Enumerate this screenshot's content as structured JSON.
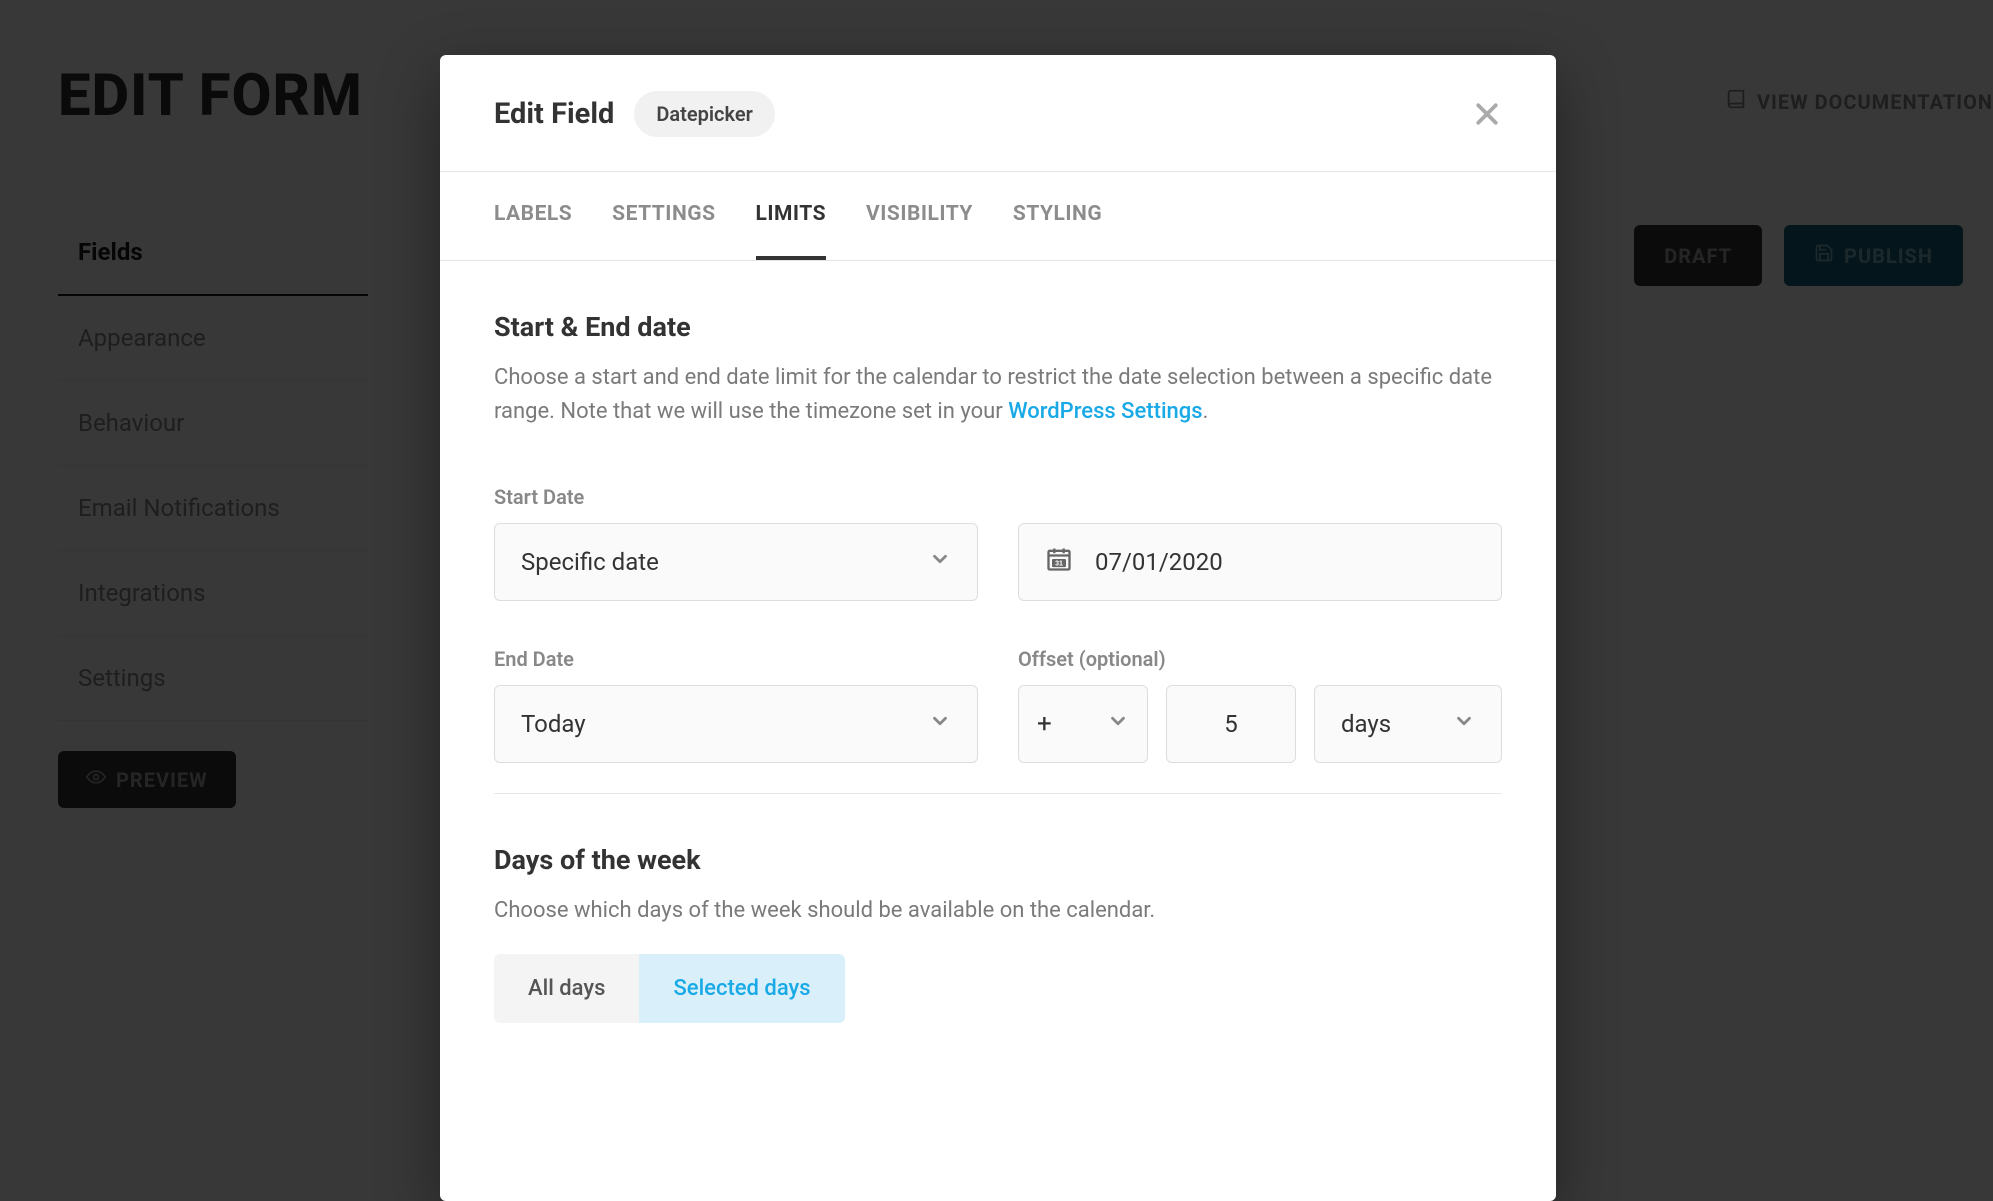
{
  "bg": {
    "title": "EDIT FORM",
    "docs_label": "VIEW DOCUMENTATION",
    "sidebar": {
      "items": [
        {
          "label": "Fields",
          "active": true
        },
        {
          "label": "Appearance"
        },
        {
          "label": "Behaviour"
        },
        {
          "label": "Email Notifications"
        },
        {
          "label": "Integrations"
        },
        {
          "label": "Settings"
        }
      ],
      "preview_label": "PREVIEW"
    },
    "buttons": {
      "draft_label": "DRAFT",
      "publish_label": "PUBLISH"
    }
  },
  "modal": {
    "title": "Edit Field",
    "badge": "Datepicker",
    "tabs": [
      {
        "label": "LABELS"
      },
      {
        "label": "SETTINGS"
      },
      {
        "label": "LIMITS",
        "active": true
      },
      {
        "label": "VISIBILITY"
      },
      {
        "label": "STYLING"
      }
    ],
    "section1": {
      "title": "Start & End date",
      "desc_before": "Choose a start and end date limit for the calendar to restrict the date selection between a specific date range. Note that we will use the timezone set in your ",
      "desc_link": "WordPress Settings",
      "desc_after": "."
    },
    "start": {
      "label": "Start Date",
      "mode": "Specific date",
      "value": "07/01/2020"
    },
    "end": {
      "label": "End Date",
      "mode": "Today",
      "offset_label": "Offset (optional)",
      "sign": "+",
      "number": "5",
      "unit": "days"
    },
    "section2": {
      "title": "Days of the week",
      "desc": "Choose which days of the week should be available on the calendar.",
      "all_label": "All days",
      "selected_label": "Selected days"
    }
  }
}
